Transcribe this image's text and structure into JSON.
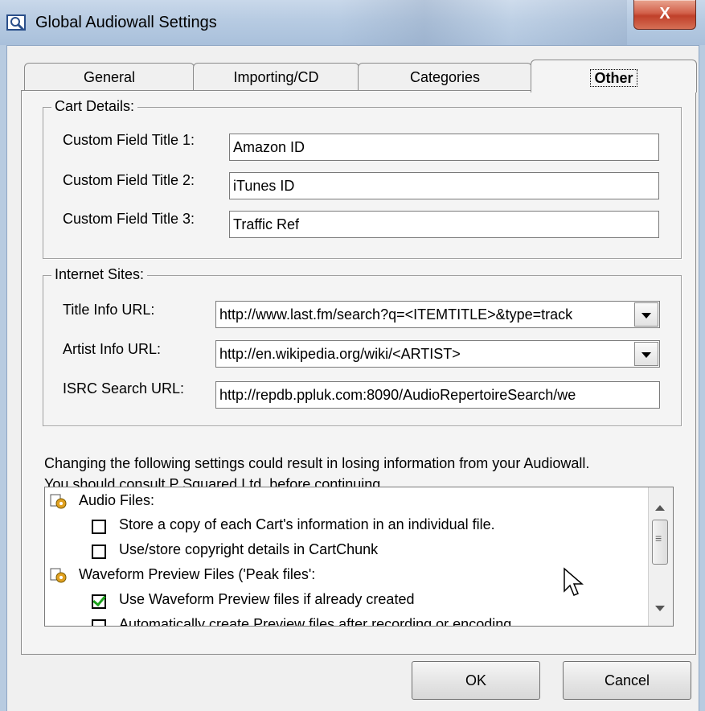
{
  "window": {
    "title": "Global Audiowall Settings",
    "close_glyph": "X",
    "icon": "speaker-search-icon"
  },
  "tabs": [
    {
      "label": "General",
      "active": false
    },
    {
      "label": "Importing/CD",
      "active": false
    },
    {
      "label": "Categories",
      "active": false
    },
    {
      "label": "Other",
      "active": true
    }
  ],
  "cart_details": {
    "legend": "Cart Details:",
    "fields": [
      {
        "label": "Custom Field Title 1:",
        "value": "Amazon ID"
      },
      {
        "label": "Custom Field Title 2:",
        "value": "iTunes ID"
      },
      {
        "label": "Custom Field Title 3:",
        "value": "Traffic Ref"
      }
    ]
  },
  "internet_sites": {
    "legend": "Internet Sites:",
    "title_info": {
      "label": "Title Info URL:",
      "value": "http://www.last.fm/search?q=<ITEMTITLE>&type=track"
    },
    "artist_info": {
      "label": "Artist Info URL:",
      "value": "http://en.wikipedia.org/wiki/<ARTIST>"
    },
    "isrc_search": {
      "label": "ISRC Search URL:",
      "value": "http://repdb.ppluk.com:8090/AudioRepertoireSearch/we"
    }
  },
  "warning": {
    "line1": "Changing the following settings could result in losing information from your Audiowall.",
    "line2": "You should consult P Squared Ltd. before continuing."
  },
  "options_list": {
    "groups": [
      {
        "label": "Audio Files:",
        "icon": "gears-icon",
        "items": [
          {
            "label": "Store a copy of each Cart's information in an individual file.",
            "checked": false
          },
          {
            "label": "Use/store copyright details in CartChunk",
            "checked": false
          }
        ]
      },
      {
        "label": "Waveform Preview Files ('Peak files':",
        "icon": "gears-icon",
        "items": [
          {
            "label": "Use Waveform Preview files if already created",
            "checked": true
          },
          {
            "label": "Automatically create Preview files after recording or encoding",
            "checked": false
          }
        ]
      }
    ]
  },
  "buttons": {
    "ok": "OK",
    "cancel": "Cancel"
  },
  "colors": {
    "check_green": "#1ba21b",
    "titlebar": "#b7cbe2",
    "close_red": "#c0402a"
  }
}
